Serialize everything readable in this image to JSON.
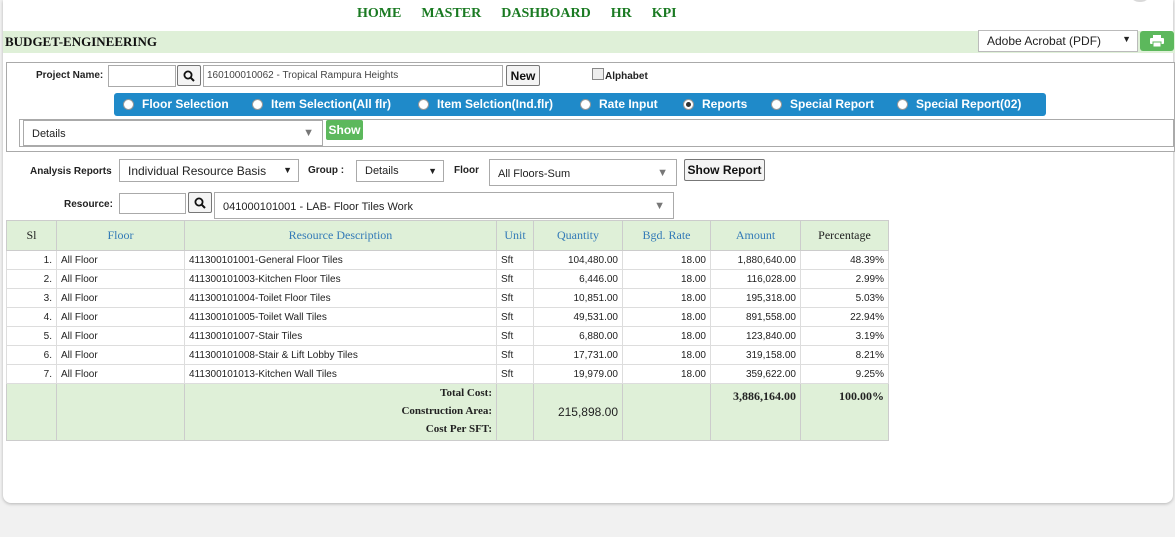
{
  "nav": [
    "HOME",
    "MASTER",
    "DASHBOARD",
    "HR",
    "KPI"
  ],
  "page_title": "BUDGET-ENGINEERING",
  "export": {
    "format": "Adobe Acrobat (PDF)",
    "print_icon": "printer-icon"
  },
  "filters": {
    "project_label": "Project Name:",
    "project_code": "",
    "project_value": "160100010062 - Tropical Rampura Heights",
    "new_label": "New",
    "alphabet_label": "Alphabet",
    "alphabet_checked": false,
    "tabs": [
      {
        "label": "Floor Selection",
        "selected": false
      },
      {
        "label": "Item Selection(All flr)",
        "selected": false
      },
      {
        "label": "Item Selction(Ind.flr)",
        "selected": false
      },
      {
        "label": "Rate Input",
        "selected": false
      },
      {
        "label": "Reports",
        "selected": true
      },
      {
        "label": "Special Report",
        "selected": false
      },
      {
        "label": "Special Report(02)",
        "selected": false
      }
    ],
    "details_select": "Details",
    "show_label": "Show"
  },
  "analysis": {
    "label": "Analysis Reports",
    "report_type": "Individual Resource Basis",
    "group_label": "Group :",
    "group_value": "Details",
    "floor_label": "Floor",
    "floor_value": "All Floors-Sum",
    "show_report_label": "Show Report",
    "resource_label": "Resource:",
    "resource_code": "",
    "resource_value": "041000101001 - LAB- Floor Tiles Work"
  },
  "table": {
    "columns": [
      "Sl",
      "Floor",
      "Resource Description",
      "Unit",
      "Quantity",
      "Bgd. Rate",
      "Amount",
      "Percentage"
    ],
    "rows": [
      [
        "1.",
        "All Floor",
        "411300101001-General Floor Tiles",
        "Sft",
        "104,480.00",
        "18.00",
        "1,880,640.00",
        "48.39%"
      ],
      [
        "2.",
        "All Floor",
        "411300101003-Kitchen Floor Tiles",
        "Sft",
        "6,446.00",
        "18.00",
        "116,028.00",
        "2.99%"
      ],
      [
        "3.",
        "All Floor",
        "411300101004-Toilet Floor Tiles",
        "Sft",
        "10,851.00",
        "18.00",
        "195,318.00",
        "5.03%"
      ],
      [
        "4.",
        "All Floor",
        "411300101005-Toilet Wall Tiles",
        "Sft",
        "49,531.00",
        "18.00",
        "891,558.00",
        "22.94%"
      ],
      [
        "5.",
        "All Floor",
        "411300101007-Stair Tiles",
        "Sft",
        "6,880.00",
        "18.00",
        "123,840.00",
        "3.19%"
      ],
      [
        "6.",
        "All Floor",
        "411300101008-Stair & Lift Lobby Tiles",
        "Sft",
        "17,731.00",
        "18.00",
        "319,158.00",
        "8.21%"
      ],
      [
        "7.",
        "All Floor",
        "411300101013-Kitchen Wall Tiles",
        "Sft",
        "19,979.00",
        "18.00",
        "359,622.00",
        "9.25%"
      ]
    ],
    "footer": {
      "total_cost_label": "Total Cost:",
      "construction_area_label": "Construction Area:",
      "cost_per_sft_label": "Cost Per SFT:",
      "total_quantity": "215,898.00",
      "total_amount": "3,886,164.00",
      "total_percentage": "100.00%"
    }
  }
}
